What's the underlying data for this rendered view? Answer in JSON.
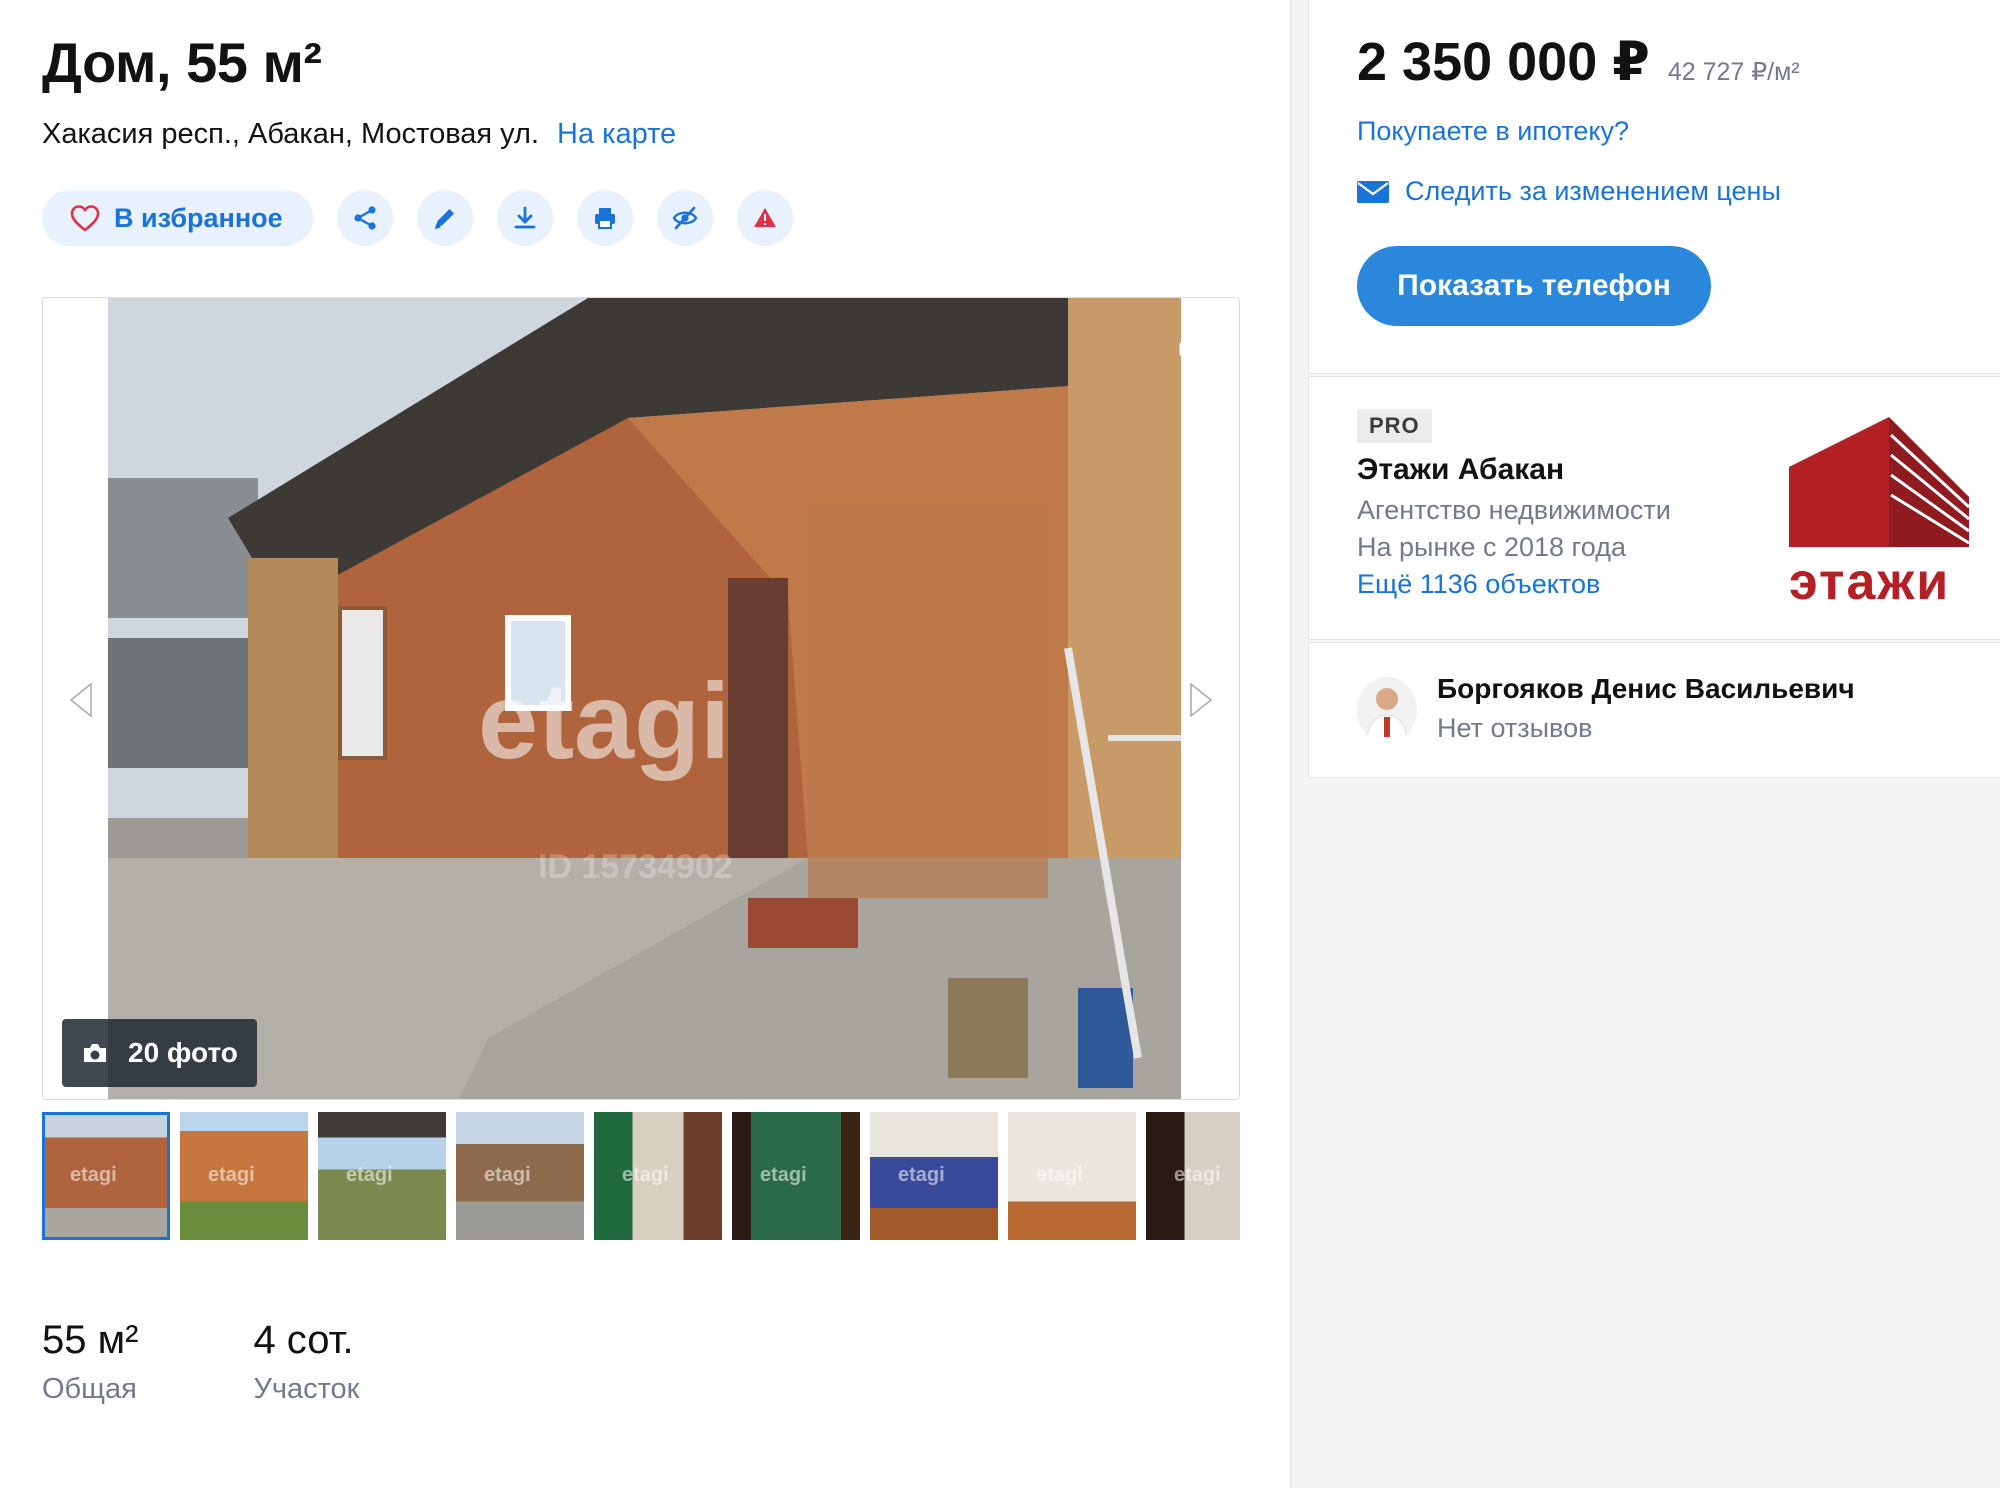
{
  "listing": {
    "title": "Дом, 55 м²",
    "address": "Хакасия респ., Абакан, Мостовая ул.",
    "map_link": "На карте"
  },
  "actions": {
    "favorite_label": "В избранное",
    "icons": [
      "share-icon",
      "edit-icon",
      "download-icon",
      "print-icon",
      "hide-icon",
      "report-icon"
    ]
  },
  "gallery": {
    "watermark": "etagi",
    "photo_id": "ID 15734902",
    "photo_count_label": "20 фото",
    "thumb_watermark": "etagi"
  },
  "facts": [
    {
      "value": "55 м²",
      "label": "Общая"
    },
    {
      "value": "4 сот.",
      "label": "Участок"
    }
  ],
  "price": {
    "total": "2 350 000 ₽",
    "per_sqm": "42 727 ₽/м²",
    "mortgage_link": "Покупаете в ипотеку?",
    "watch_link": "Следить за изменением цены",
    "phone_button": "Показать телефон"
  },
  "agency": {
    "badge": "PRO",
    "name": "Этажи Абакан",
    "type": "Агентство недвижимости",
    "since": "На рынке с 2018 года",
    "more_link": "Ещё 1136 объектов",
    "logo_text": "этажи"
  },
  "agent": {
    "name": "Боргояков Денис Васильевич",
    "reviews": "Нет отзывов"
  },
  "colors": {
    "accent": "#1a73d9",
    "button": "#2b87db",
    "muted": "#737a8e",
    "brand_red": "#b32127"
  }
}
